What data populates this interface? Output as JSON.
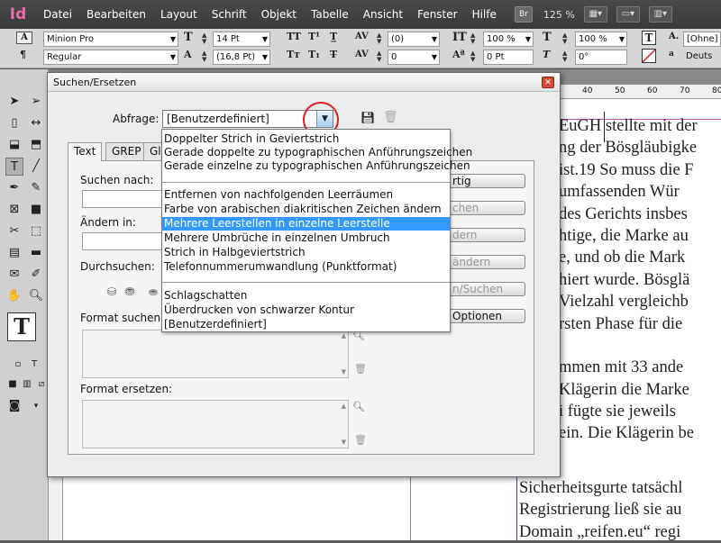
{
  "app": {
    "logo": "Id",
    "zoom": "125 %",
    "bridge_label": "Br"
  },
  "menu": [
    "Datei",
    "Bearbeiten",
    "Layout",
    "Schrift",
    "Objekt",
    "Tabelle",
    "Ansicht",
    "Fenster",
    "Hilfe"
  ],
  "control_panel": {
    "font_family": "Minion Pro",
    "font_style": "Regular",
    "font_size": "14 Pt",
    "leading": "(16,8 Pt)",
    "kerning": "(0)",
    "tracking": "0",
    "vertical_scale": "100 %",
    "baseline_shift": "0 Pt",
    "horizontal_scale": "100 %",
    "skew": "0°",
    "char_style": "[Ohne]",
    "language": "Deuts"
  },
  "ruler": {
    "top_marks": [
      "40",
      "50",
      "60",
      "70",
      "80"
    ]
  },
  "document": {
    "lines": [
      "EuGH stellte mit der",
      "ng der Bösgläubigke",
      " ist.19 So muss die F",
      "  umfassenden Wür",
      " des Gerichts insbes",
      "htige, die Marke au",
      "e, und ob die Mark",
      "hiert wurde. Bösglä",
      " Vielzahl vergleichb",
      "rsten Phase für die",
      "",
      "mmen mit 33 ande",
      "Klägerin die Marke",
      "i fügte sie jeweils",
      "ein. Die Klägerin be",
      "Sicherheitsgurte tatsächl",
      "Registrierung ließ sie au",
      "Domain „reifen.eu“ regi"
    ]
  },
  "dialog": {
    "title": "Suchen/Ersetzen",
    "query_label": "Abfrage:",
    "query_value": "[Benutzerdefiniert]",
    "tabs": [
      "Text",
      "GREP",
      "Gly"
    ],
    "search_label": "Suchen nach:",
    "replace_label": "Ändern in:",
    "search_in_label": "Durchsuchen:",
    "format_search_label": "Format suchen:",
    "format_replace_label": "Format ersetzen:",
    "buttons": {
      "done": "rtig",
      "find": "chen",
      "change": "dern",
      "change_all": "ändern",
      "change_find": "n/Suchen",
      "more_options": "Optionen"
    },
    "dropdown_items": [
      "Doppelter Strich in Geviertstrich",
      "Gerade doppelte zu typographischen Anführungszeichen",
      "Gerade einzelne zu typographischen Anführungszeichen",
      "Entfernen von nachfolgenden Leerräumen",
      "Farbe von arabischen diakritischen Zeichen ändern",
      "Mehrere Leerstellen in einzelne Leerstelle",
      "Mehrere Umbrüche in einzelnen Umbruch",
      "Strich in Halbgeviertstrich",
      "Telefonnummerumwandlung (Punktformat)",
      "Schlagschatten",
      "Überdrucken von schwarzer Kontur",
      "[Benutzerdefiniert]"
    ],
    "selected_item": "Mehrere Leerstellen in einzelne Leerstelle"
  }
}
